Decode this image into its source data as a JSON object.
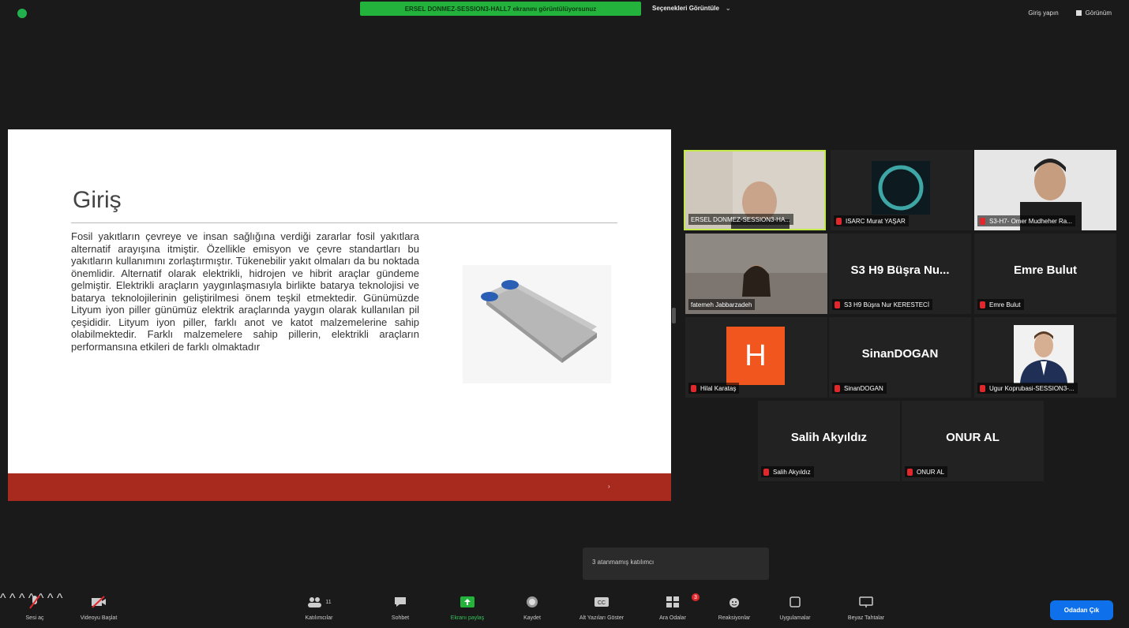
{
  "top": {
    "share_banner": "ERSEL DONMEZ-SESSION3-HALL7 ekranını görüntülüyorsunuz",
    "view_options": "Seçenekleri Görüntüle",
    "signin": "Giriş yapın",
    "view": "Görünüm"
  },
  "slide": {
    "title": "Giriş",
    "body": "Fosil yakıtların çevreye ve insan sağlığına verdiği zararlar fosil yakıtlara alternatif arayışına itmiştir. Özellikle emisyon ve çevre standartları bu yakıtların kullanımını zorlaştırmıştır. Tükenebilir yakıt olmaları da bu noktada önemlidir. Alternatif olarak elektrikli, hidrojen ve hibrit araçlar gündeme gelmiştir. Elektrikli araçların yaygınlaşmasıyla birlikte batarya teknolojisi ve batarya teknolojilerinin geliştirilmesi önem teşkil etmektedir. Günümüzde Lityum iyon piller günümüz elektrik araçlarında yaygın olarak kullanılan pil çeşididir. Lityum iyon piller, farklı anot ve katot malzemelerine sahip olabilmektedir. Farklı malzemelere sahip pillerin, elektrikli araçların performansına etkileri de farklı olmaktadır",
    "footer_arrow": "›"
  },
  "participants": {
    "p1_label": "ERSEL DONMEZ-SESSION3-HA...",
    "p2_label": "ISARC Murat YAŞAR",
    "p3_label": "S3-H7- Omer Mudheher Ra...",
    "p4_label": "fatemeh Jabbarzadeh",
    "p5_big": "S3 H9 Büşra Nu...",
    "p5_label": "S3 H9 Büşra Nur KERESTECİ",
    "p6_big": "Emre Bulut",
    "p6_label": "Emre Bulut",
    "p7_avatar": "H",
    "p7_label": "Hilal Karataş",
    "p8_big": "SinanDOGAN",
    "p8_label": "SinanDOGAN",
    "p9_label": "Ugur Koprubasi-SESSION3-...",
    "p10_big": "Salih Akyıldız",
    "p10_label": "Salih Akyıldız",
    "p11_big": "ONUR AL",
    "p11_label": "ONUR AL"
  },
  "toast": "3 atanmamış katılımcı",
  "toolbar": {
    "mute": "Sesi aç",
    "video": "Videoyu Başlat",
    "participants": "Katılımcılar",
    "participants_count": "11",
    "chat": "Sohbet",
    "share": "Ekranı paylaş",
    "record": "Kaydet",
    "cc": "Alt Yazıları Göster",
    "breakout": "Ara Odalar",
    "breakout_badge": "3",
    "reactions": "Reaksiyonlar",
    "apps": "Uygulamalar",
    "whiteboard": "Beyaz Tahtalar",
    "leave": "Odadan Çık"
  },
  "colors": {
    "share_green": "#23b33c",
    "slide_footer": "#a82a1f",
    "leave_blue": "#0e71eb",
    "active_border": "#c3e84a",
    "mic_red": "#e0282c",
    "avatar_orange": "#f0561d"
  }
}
